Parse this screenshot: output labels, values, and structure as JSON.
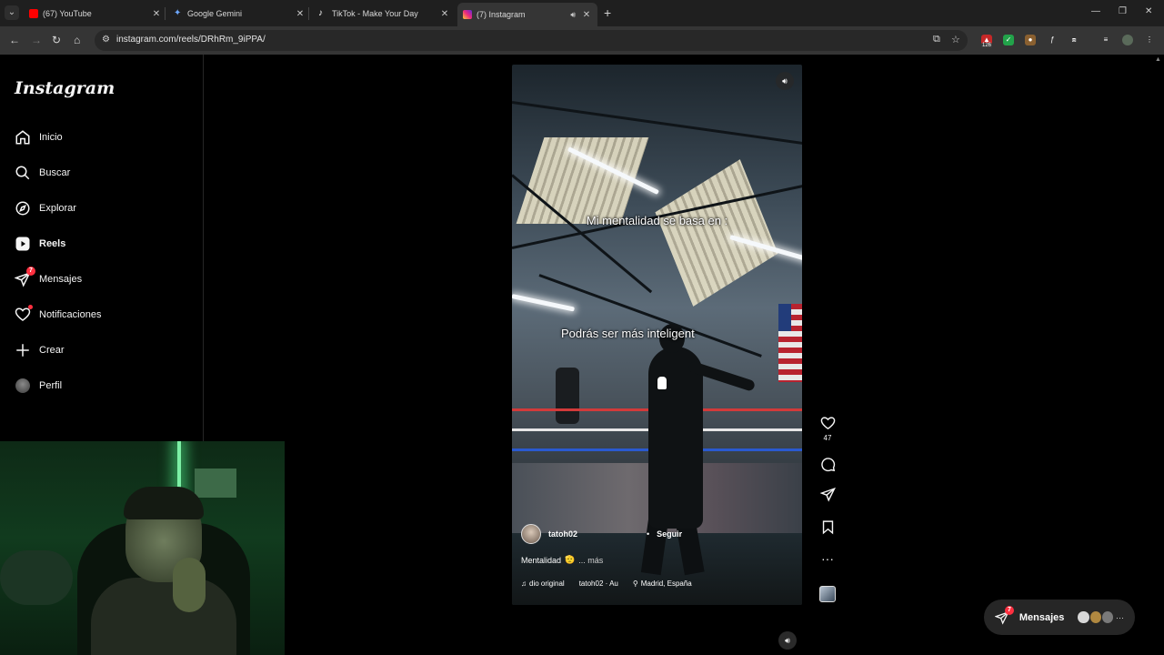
{
  "browser": {
    "tabs": [
      {
        "title": "(67) YouTube",
        "favicon_color": "#ff0000"
      },
      {
        "title": "Google Gemini",
        "favicon_color": "#4b8bf5"
      },
      {
        "title": "TikTok - Make Your Day",
        "favicon_color": "#111111"
      },
      {
        "title": "(7) Instagram",
        "favicon_color": "#e1306c"
      }
    ],
    "url": "instagram.com/reels/DRhRm_9iPPA/",
    "extension_badge": "126"
  },
  "sidebar": {
    "logo": "Instagram",
    "items": [
      {
        "label": "Inicio",
        "icon": "home-icon"
      },
      {
        "label": "Buscar",
        "icon": "search-icon"
      },
      {
        "label": "Explorar",
        "icon": "compass-icon"
      },
      {
        "label": "Reels",
        "icon": "reels-icon"
      },
      {
        "label": "Mensajes",
        "icon": "messenger-icon",
        "badge": "7"
      },
      {
        "label": "Notificaciones",
        "icon": "heart-icon"
      },
      {
        "label": "Crear",
        "icon": "plus-icon"
      },
      {
        "label": "Perfil",
        "icon": "profile-avatar"
      }
    ]
  },
  "reel": {
    "caption_top": "Mi mentalidad se basa en :",
    "caption_mid": "Podrás ser más inteligent",
    "username": "tatoh02",
    "follow_label": "Seguir",
    "description": "Mentalidad",
    "description_emoji": "🫡",
    "more_label": "... más",
    "audio_label": "dio original",
    "audio_author": "tatoh02 · Au",
    "location": "Madrid, España",
    "likes": "47"
  },
  "messages_pill": {
    "label": "Mensajes",
    "badge": "7"
  },
  "colors": {
    "accent": "#ff3040",
    "background": "#000000",
    "sidebar_border": "#262626"
  }
}
